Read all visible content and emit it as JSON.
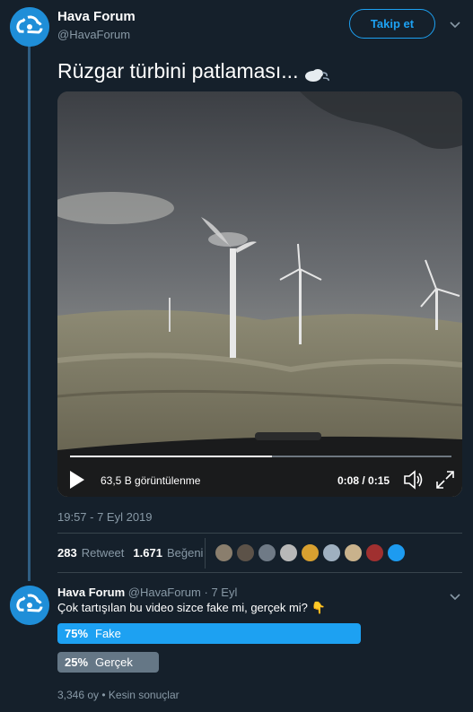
{
  "account": {
    "name": "Hava Forum",
    "handle": "@HavaForum"
  },
  "header": {
    "follow_label": "Takip et"
  },
  "tweet": {
    "text": "Rüzgar türbini patlaması...",
    "video": {
      "views": "63,5 B görüntülenme",
      "time": "0:08 / 0:15",
      "progress": 0.53
    },
    "timestamp": "19:57 - 7 Eyl 2019",
    "retweets": "283",
    "retweets_label": "Retweet",
    "likes": "1.671",
    "likes_label": "Beğeni",
    "liker_colors": [
      "#8a7e6d",
      "#5c5248",
      "#6f7a86",
      "#b8b8b8",
      "#d8a030",
      "#9fb0c0",
      "#c9b28c",
      "#a03030",
      "#1d9bf0"
    ]
  },
  "reply": {
    "name": "Hava Forum",
    "handle": "@HavaForum",
    "age": "· 7 Eyl",
    "text": "Çok tartışılan bu video sizce fake mi, gerçek mi? 👇",
    "poll": {
      "options": [
        {
          "pct": "75%",
          "label": "Fake",
          "fraction": 0.75,
          "color": "#1da1f2"
        },
        {
          "pct": "25%",
          "label": "Gerçek",
          "fraction": 0.25,
          "color": "#657786"
        }
      ],
      "footer": "3,346 oy • Kesin sonuçlar"
    }
  }
}
